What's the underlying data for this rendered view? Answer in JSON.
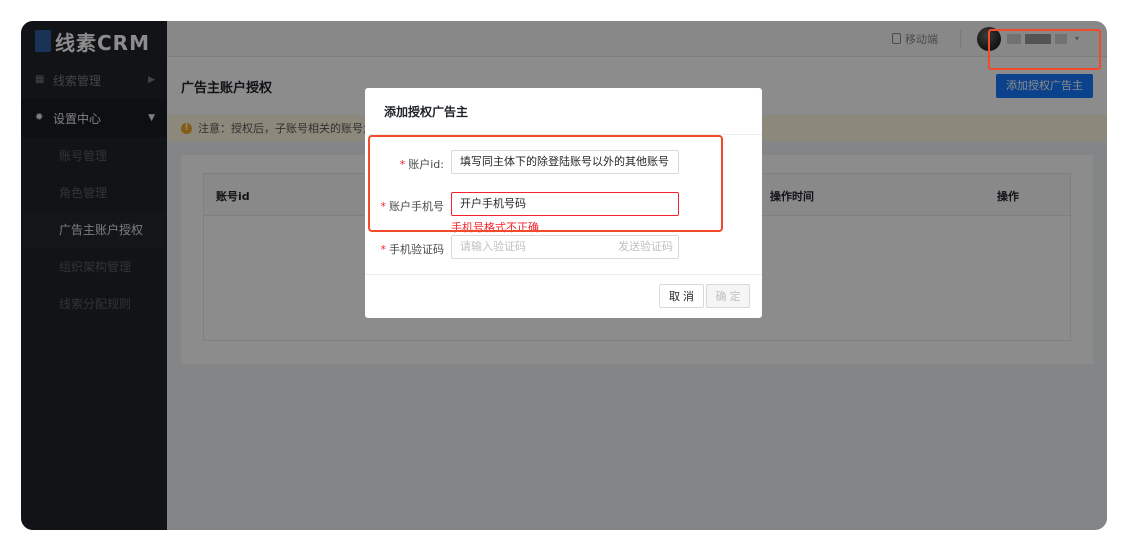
{
  "app": {
    "logo_text": "线素CRM"
  },
  "topbar": {
    "mobile_label": "移动端"
  },
  "sidebar": {
    "groups": [
      {
        "label": "线索管理",
        "icon": "grid-icon"
      },
      {
        "label": "设置中心",
        "icon": "gear-icon"
      }
    ],
    "items": [
      {
        "label": "账号管理"
      },
      {
        "label": "角色管理"
      },
      {
        "label": "广告主账户授权"
      },
      {
        "label": "组织架构管理"
      },
      {
        "label": "线索分配规则"
      }
    ]
  },
  "page": {
    "title": "广告主账户授权",
    "add_button": "添加授权广告主",
    "notice": "注意：授权后，子账号相关的账号角",
    "table": {
      "columns": [
        "账号id",
        "操作时间",
        "操作"
      ]
    }
  },
  "modal": {
    "title": "添加授权广告主",
    "fields": [
      {
        "label": "账户id:",
        "value": "填写同主体下的除登陆账号以外的其他账号"
      },
      {
        "label": "账户手机号",
        "value": "开户手机号码",
        "error": "手机号格式不正确"
      },
      {
        "label": "手机验证码",
        "placeholder": "请输入验证码",
        "action": "发送验证码"
      }
    ],
    "cancel": "取 消",
    "ok": "确 定"
  },
  "colors": {
    "primary": "#1677ff",
    "error": "#f5222d",
    "highlight": "#f24a2a",
    "sidebar": "#1f2329"
  }
}
